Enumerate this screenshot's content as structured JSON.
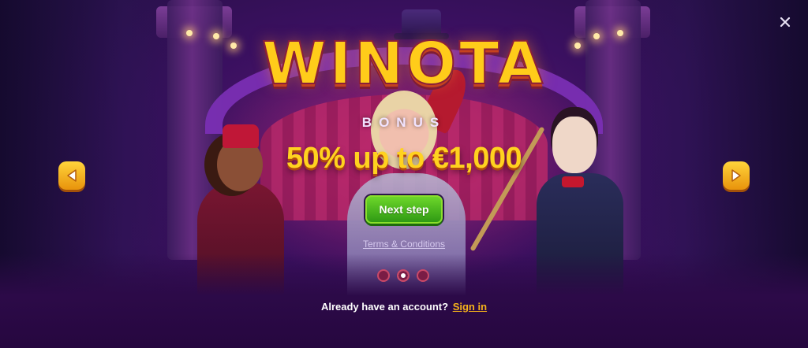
{
  "promo": {
    "logo_text": "WINOTA",
    "bonus_label": "BONUS",
    "offer": "50% up to €1,000",
    "cta_label": "Next step",
    "terms_link": "Terms & Conditions"
  },
  "carousel": {
    "slide_count": 3,
    "active_index": 1
  },
  "footer": {
    "account_prompt": "Already have an account?",
    "signin_link": "Sign in"
  },
  "icons": {
    "close": "close-icon",
    "prev": "chevron-left-icon",
    "next": "chevron-right-icon"
  },
  "colors": {
    "accent_gold": "#ffd21f",
    "cta_green": "#4cc021",
    "signin_orange": "#f5b21a",
    "background": "#2a0a45"
  }
}
